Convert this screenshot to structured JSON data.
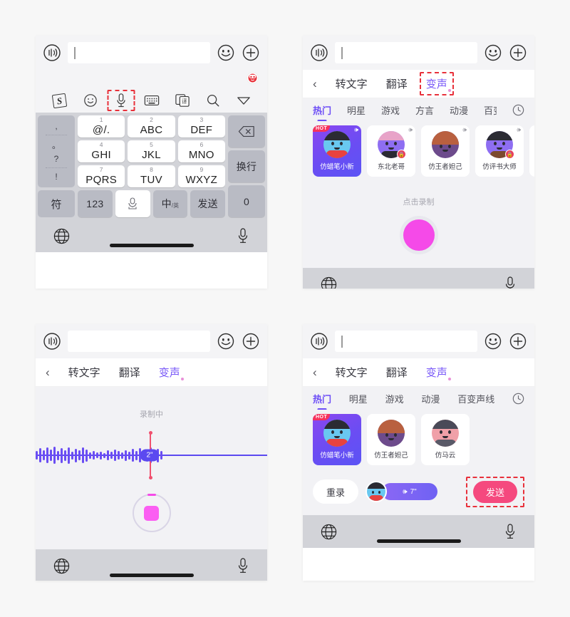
{
  "panels": {
    "p1": {
      "name": "sogou-keyboard-default",
      "input": {
        "value": "",
        "placeholder": ""
      },
      "toolbar": [
        {
          "icon": "sogou-logo-icon",
          "label": "S"
        },
        {
          "icon": "emoji-icon",
          "label": ""
        },
        {
          "icon": "microphone-icon",
          "label": "",
          "highlighted": true
        },
        {
          "icon": "keyboard-icon",
          "label": ""
        },
        {
          "icon": "translate-icon",
          "label": "译"
        },
        {
          "icon": "search-icon",
          "label": ""
        },
        {
          "icon": "chevron-down-icon",
          "label": ""
        }
      ],
      "punct_keys": [
        ",",
        "。",
        "?",
        "!"
      ],
      "keys": [
        {
          "num": "1",
          "label": "@/."
        },
        {
          "num": "2",
          "label": "ABC"
        },
        {
          "num": "3",
          "label": "DEF"
        },
        {
          "num": "4",
          "label": "GHI"
        },
        {
          "num": "5",
          "label": "JKL"
        },
        {
          "num": "6",
          "label": "MNO"
        },
        {
          "num": "7",
          "label": "PQRS"
        },
        {
          "num": "8",
          "label": "TUV"
        },
        {
          "num": "9",
          "label": "WXYZ"
        }
      ],
      "right_keys": [
        {
          "label": "⌫",
          "name": "backspace-key"
        },
        {
          "label": "换行",
          "name": "newline-key"
        },
        {
          "label": "0",
          "name": "zero-key"
        }
      ],
      "bottom_keys": {
        "symbol": "符",
        "numeric": "123",
        "space": "",
        "lang_main": "中",
        "lang_sub": "/英",
        "send": "发送"
      }
    },
    "p2": {
      "name": "voice-changer-browse",
      "input": {
        "value": "",
        "placeholder": ""
      },
      "header": {
        "back": "‹",
        "tabs": [
          {
            "label": "转文字",
            "active": false
          },
          {
            "label": "翻译",
            "active": false
          },
          {
            "label": "变声",
            "active": true,
            "highlighted": true
          }
        ]
      },
      "categories": [
        {
          "label": "热门",
          "active": true
        },
        {
          "label": "明星",
          "active": false
        },
        {
          "label": "游戏",
          "active": false
        },
        {
          "label": "方言",
          "active": false
        },
        {
          "label": "动漫",
          "active": false
        },
        {
          "label": "百变",
          "active": false
        }
      ],
      "history_icon": "clock-icon",
      "cards": [
        {
          "name": "仿蜡笔小新",
          "selected": true,
          "hot": true,
          "locked": false
        },
        {
          "name": "东北老哥",
          "selected": false,
          "hot": false,
          "locked": true
        },
        {
          "name": "仿王者妲己",
          "selected": false,
          "hot": false,
          "locked": false
        },
        {
          "name": "仿评书大师",
          "selected": false,
          "hot": false,
          "locked": true
        },
        {
          "name": "",
          "selected": false,
          "hot": false,
          "locked": false
        }
      ],
      "record_hint": "点击录制"
    },
    "p3": {
      "name": "voice-changer-recording",
      "input": {
        "value": "",
        "placeholder": ""
      },
      "header": {
        "back": "‹",
        "tabs": [
          {
            "label": "转文字",
            "active": false
          },
          {
            "label": "翻译",
            "active": false
          },
          {
            "label": "变声",
            "active": true,
            "highlighted": false
          }
        ]
      },
      "status": "录制中",
      "elapsed": "2\"",
      "waveform_heights": [
        12,
        20,
        14,
        22,
        16,
        24,
        13,
        21,
        15,
        23,
        11,
        19,
        14,
        22,
        17,
        9,
        12,
        8,
        11,
        7,
        14,
        10,
        16,
        12,
        9,
        15,
        11,
        18,
        13,
        20,
        10,
        17,
        22,
        14,
        19,
        12
      ]
    },
    "p4": {
      "name": "voice-changer-preview",
      "input": {
        "value": "",
        "placeholder": ""
      },
      "header": {
        "back": "‹",
        "tabs": [
          {
            "label": "转文字",
            "active": false
          },
          {
            "label": "翻译",
            "active": false
          },
          {
            "label": "变声",
            "active": true,
            "highlighted": false
          }
        ]
      },
      "categories": [
        {
          "label": "热门",
          "active": true
        },
        {
          "label": "明星",
          "active": false
        },
        {
          "label": "游戏",
          "active": false
        },
        {
          "label": "动漫",
          "active": false
        },
        {
          "label": "百变声线",
          "active": false
        }
      ],
      "history_icon": "clock-icon",
      "cards": [
        {
          "name": "仿蜡笔小新",
          "selected": true,
          "hot": true,
          "locked": false
        },
        {
          "name": "仿王者妲己",
          "selected": false,
          "hot": false,
          "locked": false
        },
        {
          "name": "仿马云",
          "selected": false,
          "hot": false,
          "locked": false
        }
      ],
      "redo_label": "重录",
      "clip_duration": "7\"",
      "send_label": "发送",
      "send_highlighted": true
    }
  },
  "colors": {
    "accent_purple": "#6c4df6",
    "accent_magenta": "#f54ae8",
    "send_pink": "#f5497e",
    "highlight_red": "#e8313b",
    "keyboard_bg": "#d2d3d8",
    "panel_bg": "#f2f2f5"
  }
}
